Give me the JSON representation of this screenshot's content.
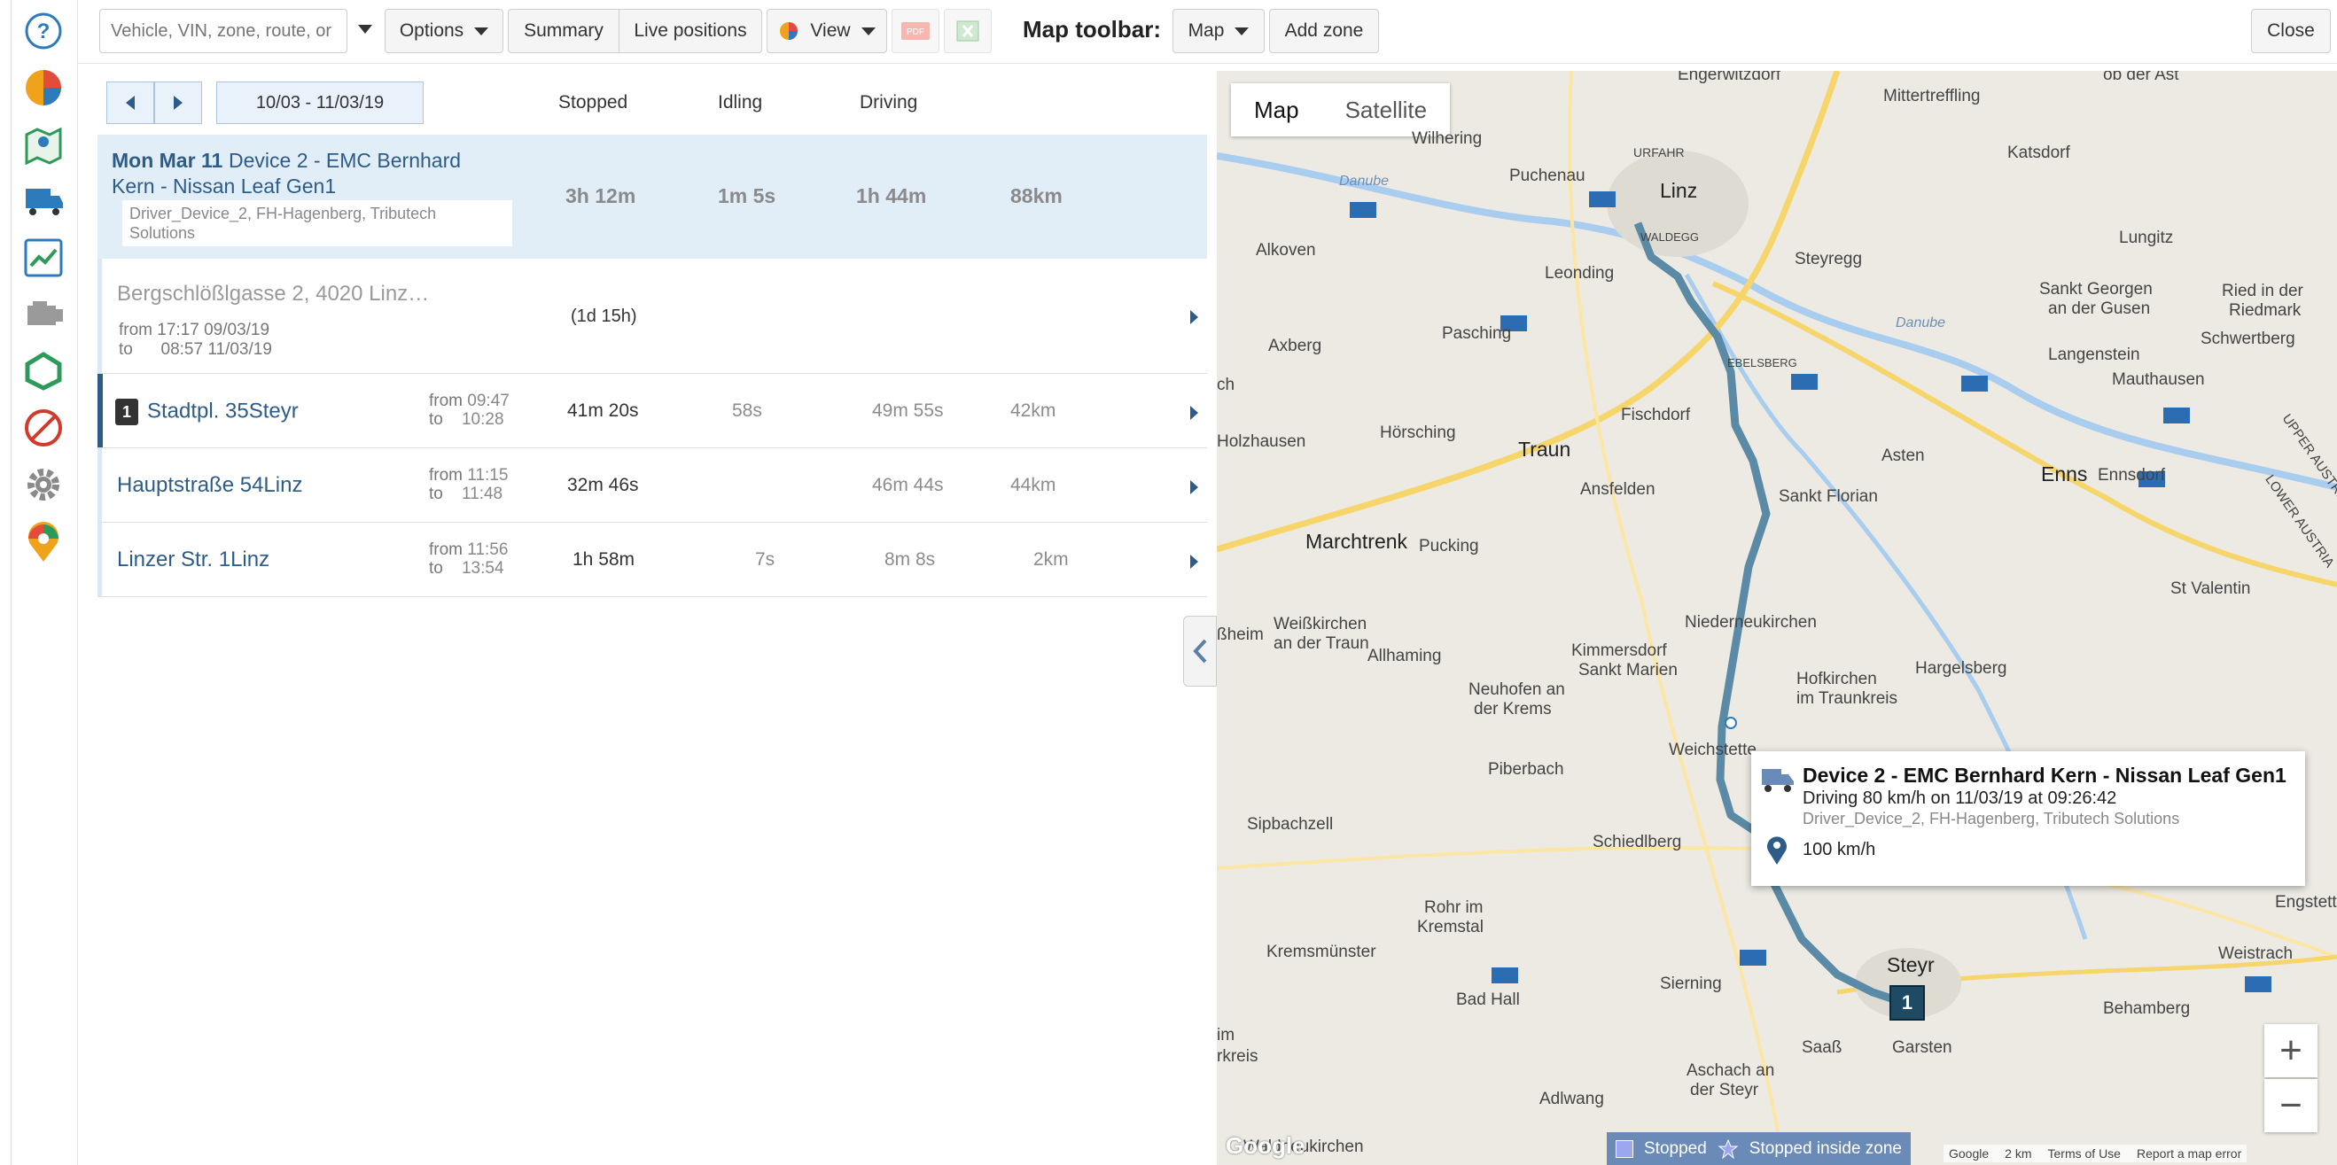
{
  "toolbar": {
    "search_placeholder": "Vehicle, VIN, zone, route, or",
    "options_label": "Options",
    "summary_label": "Summary",
    "live_positions_label": "Live positions",
    "view_label": "View",
    "pdf_label": "PDF",
    "map_toolbar_label": "Map toolbar:",
    "map_label": "Map",
    "add_zone_label": "Add zone",
    "close_label": "Close"
  },
  "sidebar": {
    "icons": [
      "help-icon",
      "reports-icon",
      "map-icon",
      "vehicles-icon",
      "activity-icon",
      "engine-icon",
      "zones-icon",
      "exceptions-icon",
      "settings-icon",
      "places-icon"
    ]
  },
  "trips": {
    "date_range": "10/03 - 11/03/19",
    "headers": {
      "stopped": "Stopped",
      "idling": "Idling",
      "driving": "Driving"
    },
    "day": {
      "date": "Mon Mar 11",
      "device_line1": "Device 2 - EMC Bernhard",
      "device_line2": "Kern - Nissan Leaf Gen1",
      "driver_line1": "Driver_Device_2, FH-Hagenberg, Tributech",
      "driver_line2": "Solutions",
      "stopped": "3h 12m",
      "idling": "1m 5s",
      "driving": "1h 44m",
      "distance": "88km"
    },
    "stop": {
      "address": "Bergschlößlgasse 2, 4020 Linz…",
      "from": "from 17:17 09/03/19",
      "to": "to      08:57 11/03/19",
      "duration": "(1d 15h)"
    },
    "rows": [
      {
        "number": "1",
        "title": "Stadtpl. 35Steyr",
        "from_label": "from",
        "from": "09:47",
        "to_label": "to",
        "to": "10:28",
        "stopped": "41m 20s",
        "idling": "58s",
        "driving": "49m 55s",
        "distance": "42km"
      },
      {
        "number": "",
        "title": "Hauptstraße 54Linz",
        "from_label": "from",
        "from": "11:15",
        "to_label": "to",
        "to": "11:48",
        "stopped": "32m 46s",
        "idling": "",
        "driving": "46m 44s",
        "distance": "44km"
      },
      {
        "number": "",
        "title": "Linzer Str. 1Linz",
        "from_label": "from",
        "from": "11:56",
        "to_label": "to",
        "to": "13:54",
        "stopped": "1h 58m",
        "idling": "7s",
        "driving": "8m 8s",
        "distance": "2km"
      }
    ]
  },
  "map": {
    "type_map": "Map",
    "type_satellite": "Satellite",
    "places": {
      "engerwitzdorf": "Engerwitzdorf",
      "mittertreffling": "Mittertreffling",
      "ob_der_ast": "ob der Ast",
      "wilhering": "Wilhering",
      "puchenau": "Puchenau",
      "urfahr": "URFAHR",
      "linz": "Linz",
      "katsdorf": "Katsdorf",
      "danube1": "Danube",
      "waldegg": "WALDEGG",
      "alkoven": "Alkoven",
      "leonding": "Leonding",
      "steyregg": "Steyregg",
      "lungitz": "Lungitz",
      "sankt_georgen": "Sankt Georgen",
      "an_der_gusen": "an der Gusen",
      "ried": "Ried in der",
      "riedmark": "Riedmark",
      "schwertberg": "Schwertberg",
      "danube2": "Danube",
      "axberg": "Axberg",
      "pasching": "Pasching",
      "ebelsberg": "EBELSBERG",
      "langenstein": "Langenstein",
      "mauthausen": "Mauthausen",
      "holzhausen": "Holzhausen",
      "horsching": "Hörsching",
      "fischdorf": "Fischdorf",
      "traun": "Traun",
      "asten": "Asten",
      "enns": "Enns",
      "ennsdorf": "Ennsdorf",
      "upper_austria": "UPPER AUSTRIA",
      "lower_austria": "LOWER AUSTRIA",
      "ansfelden": "Ansfelden",
      "sankt_florian": "Sankt Florian",
      "marchtrenk": "Marchtrenk",
      "pucking": "Pucking",
      "st_valentin": "St Valentin",
      "weisskirchen": "Weißkirchen",
      "an_der_traun": "an der Traun",
      "niederneukirchen": "Niederneukirchen",
      "allhaming": "Allhaming",
      "kimmersdorf": "Kimmersdorf",
      "sankt_marien": "Sankt Marien",
      "hargelsberg": "Hargelsberg",
      "neuhofen": "Neuhofen an",
      "der_krems": "der Krems",
      "hofkirchen": "Hofkirchen",
      "im_traunkreis": "im Traunkreis",
      "weichstetten": "Weichstette",
      "piberbach": "Piberbach",
      "sipbachzell": "Sipbachzell",
      "schiedlberg": "Schiedlberg",
      "rohr": "Rohr im",
      "kremstal": "Kremstal",
      "engstetten": "Engstette",
      "kremsmunster": "Kremsmünster",
      "sierning": "Sierning",
      "steyr": "Steyr",
      "weistrach": "Weistrach",
      "bad_hall": "Bad Hall",
      "behamberg": "Behamberg",
      "sass": "Saaß",
      "garsten": "Garsten",
      "aschach": "Aschach an",
      "der_steyr": "der Steyr",
      "adlwang": "Adlwang",
      "waldneukirchen": "Waldneukirchen",
      "sheim": "ßheim",
      "ch": "ch",
      "im": "im",
      "rkreis": "rkreis"
    },
    "popup": {
      "title": "Device 2 - EMC Bernhard Kern - Nissan Leaf Gen1",
      "line2": "Driving 80 km/h on 11/03/19 at 09:26:42",
      "line3": "Driver_Device_2, FH-Hagenberg, Tributech Solutions",
      "speed": "100 km/h"
    },
    "marker_number": "1",
    "legend": {
      "stopped": "Stopped",
      "stopped_zone": "Stopped inside zone"
    },
    "credits": {
      "google": "Google",
      "scale": "2 km",
      "terms": "Terms of Use",
      "report": "Report a map error"
    },
    "google_logo": "Google",
    "zoom_in": "+",
    "zoom_out": "−"
  }
}
